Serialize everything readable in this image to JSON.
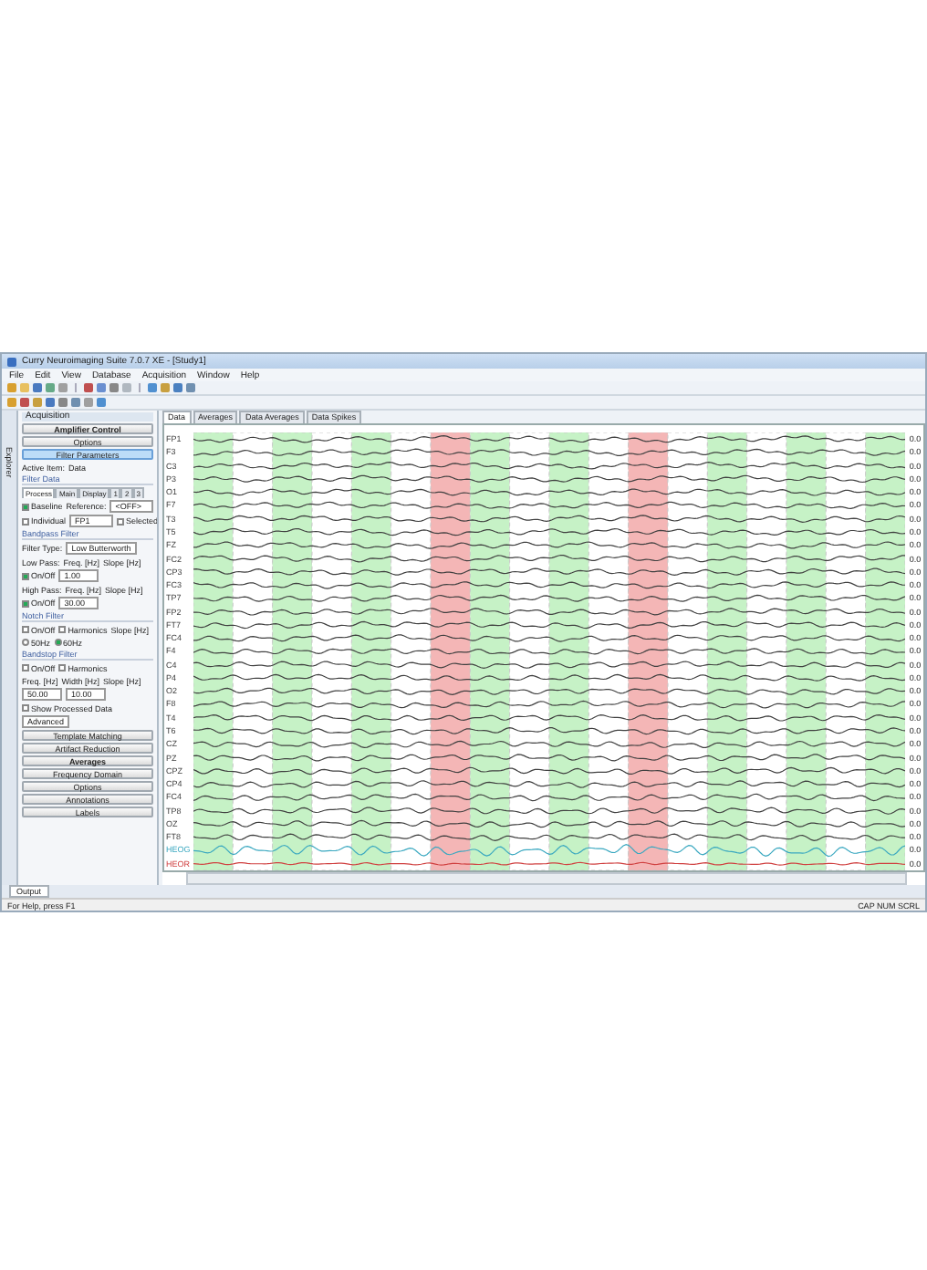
{
  "window": {
    "title": "Curry Neuroimaging Suite 7.0.7 XE - [Study1]"
  },
  "menu": [
    "File",
    "Edit",
    "View",
    "Database",
    "Acquisition",
    "Window",
    "Help"
  ],
  "side_tab": "Explorer",
  "panel": {
    "title": "Acquisition",
    "rows": [
      [
        {
          "kind": "button",
          "label": "Amplifier Control",
          "bold": true,
          "selected": false
        }
      ],
      [
        {
          "kind": "button",
          "label": "Options",
          "bold": false,
          "selected": false
        }
      ],
      [
        {
          "kind": "button",
          "label": "Filter Parameters",
          "bold": false,
          "selected": true
        }
      ],
      [
        {
          "kind": "text",
          "label": "Active Item:"
        },
        {
          "kind": "text",
          "label": "Data"
        }
      ],
      [
        {
          "kind": "section",
          "label": "Filter Data"
        }
      ],
      [
        {
          "kind": "tab",
          "label": "Process",
          "selected": true
        },
        {
          "kind": "tab",
          "label": "Main",
          "selected": false
        },
        {
          "kind": "tab",
          "label": "Display",
          "selected": false
        },
        {
          "kind": "tab",
          "label": "1",
          "selected": false
        },
        {
          "kind": "tab",
          "label": "2",
          "selected": false
        },
        {
          "kind": "tab",
          "label": "3",
          "selected": false
        }
      ],
      [
        {
          "kind": "check",
          "label": "Baseline",
          "checked": true
        },
        {
          "kind": "text",
          "label": "Reference:"
        },
        {
          "kind": "select",
          "label": "<OFF>"
        }
      ],
      [
        {
          "kind": "check",
          "label": "Individual",
          "checked": false
        },
        {
          "kind": "select",
          "label": "FP1"
        },
        {
          "kind": "check",
          "label": "Selected",
          "checked": false
        }
      ],
      [
        {
          "kind": "section",
          "label": "Bandpass Filter"
        }
      ],
      [
        {
          "kind": "text",
          "label": "Filter Type:"
        },
        {
          "kind": "select",
          "label": "Low Butterworth"
        }
      ],
      [
        {
          "kind": "text",
          "label": "Low Pass:"
        },
        {
          "kind": "text",
          "label": "Freq. [Hz]"
        },
        {
          "kind": "text",
          "label": "Slope [Hz]"
        }
      ],
      [
        {
          "kind": "check",
          "label": "On/Off",
          "checked": true
        },
        {
          "kind": "field",
          "label": "1.00"
        }
      ],
      [
        {
          "kind": "text",
          "label": "High Pass:"
        },
        {
          "kind": "text",
          "label": "Freq. [Hz]"
        },
        {
          "kind": "text",
          "label": "Slope [Hz]"
        }
      ],
      [
        {
          "kind": "check",
          "label": "On/Off",
          "checked": true
        },
        {
          "kind": "field",
          "label": "30.00"
        }
      ],
      [
        {
          "kind": "section",
          "label": "Notch Filter"
        }
      ],
      [
        {
          "kind": "check",
          "label": "On/Off",
          "checked": false
        },
        {
          "kind": "check",
          "label": "Harmonics",
          "checked": false
        },
        {
          "kind": "text",
          "label": "Slope [Hz]"
        }
      ],
      [
        {
          "kind": "radio",
          "label": "50Hz",
          "selected": false
        },
        {
          "kind": "radio",
          "label": "60Hz",
          "selected": true
        }
      ],
      [
        {
          "kind": "section",
          "label": "Bandstop Filter"
        }
      ],
      [
        {
          "kind": "check",
          "label": "On/Off",
          "checked": false
        },
        {
          "kind": "check",
          "label": "Harmonics",
          "checked": false
        }
      ],
      [
        {
          "kind": "text",
          "label": "Freq. [Hz]"
        },
        {
          "kind": "text",
          "label": "Width [Hz]"
        },
        {
          "kind": "text",
          "label": "Slope [Hz]"
        }
      ],
      [
        {
          "kind": "field",
          "label": "50.00"
        },
        {
          "kind": "field",
          "label": "10.00"
        }
      ],
      [
        {
          "kind": "check",
          "label": "Show Processed Data",
          "checked": false
        }
      ],
      [
        {
          "kind": "select",
          "label": "Advanced"
        }
      ],
      [
        {
          "kind": "button",
          "label": "Template Matching",
          "bold": false,
          "selected": false
        }
      ],
      [
        {
          "kind": "button",
          "label": "Artifact Reduction",
          "bold": false,
          "selected": false
        }
      ],
      [
        {
          "kind": "button",
          "label": "Averages",
          "bold": true,
          "selected": false
        }
      ],
      [
        {
          "kind": "button",
          "label": "Frequency Domain",
          "bold": false,
          "selected": false
        }
      ],
      [
        {
          "kind": "button",
          "label": "Options",
          "bold": false,
          "selected": false
        }
      ],
      [
        {
          "kind": "button",
          "label": "Annotations",
          "bold": false,
          "selected": false
        }
      ],
      [
        {
          "kind": "button",
          "label": "Labels",
          "bold": false,
          "selected": false
        }
      ]
    ]
  },
  "data_tabs": [
    {
      "label": "Data",
      "selected": true
    },
    {
      "label": "Averages",
      "selected": false
    },
    {
      "label": "Data Averages",
      "selected": false
    },
    {
      "label": "Data Spikes",
      "selected": false
    }
  ],
  "segments": [
    {
      "color": "#c6f2c6"
    },
    {
      "color": "#ffffff"
    },
    {
      "color": "#c6f2c6"
    },
    {
      "color": "#ffffff"
    },
    {
      "color": "#c6f2c6"
    },
    {
      "color": "#ffffff"
    },
    {
      "color": "#f4b6b6"
    },
    {
      "color": "#c6f2c6"
    },
    {
      "color": "#ffffff"
    },
    {
      "color": "#c6f2c6"
    },
    {
      "color": "#ffffff"
    },
    {
      "color": "#f4b6b6"
    },
    {
      "color": "#ffffff"
    },
    {
      "color": "#c6f2c6"
    },
    {
      "color": "#ffffff"
    },
    {
      "color": "#c6f2c6"
    },
    {
      "color": "#ffffff"
    },
    {
      "color": "#c6f2c6"
    }
  ],
  "channels": [
    {
      "name": "FP1",
      "value": "0.0",
      "color": "#404040"
    },
    {
      "name": "F3",
      "value": "0.0",
      "color": "#404040"
    },
    {
      "name": "C3",
      "value": "0.0",
      "color": "#404040"
    },
    {
      "name": "P3",
      "value": "0.0",
      "color": "#404040"
    },
    {
      "name": "O1",
      "value": "0.0",
      "color": "#404040"
    },
    {
      "name": "F7",
      "value": "0.0",
      "color": "#404040"
    },
    {
      "name": "T3",
      "value": "0.0",
      "color": "#404040"
    },
    {
      "name": "T5",
      "value": "0.0",
      "color": "#404040"
    },
    {
      "name": "FZ",
      "value": "0.0",
      "color": "#404040"
    },
    {
      "name": "FC2",
      "value": "0.0",
      "color": "#404040"
    },
    {
      "name": "CP3",
      "value": "0.0",
      "color": "#404040"
    },
    {
      "name": "FC3",
      "value": "0.0",
      "color": "#404040"
    },
    {
      "name": "TP7",
      "value": "0.0",
      "color": "#404040"
    },
    {
      "name": "FP2",
      "value": "0.0",
      "color": "#404040"
    },
    {
      "name": "FT7",
      "value": "0.0",
      "color": "#404040"
    },
    {
      "name": "FC4",
      "value": "0.0",
      "color": "#404040"
    },
    {
      "name": "F4",
      "value": "0.0",
      "color": "#404040"
    },
    {
      "name": "C4",
      "value": "0.0",
      "color": "#404040"
    },
    {
      "name": "P4",
      "value": "0.0",
      "color": "#404040"
    },
    {
      "name": "O2",
      "value": "0.0",
      "color": "#404040"
    },
    {
      "name": "F8",
      "value": "0.0",
      "color": "#404040"
    },
    {
      "name": "T4",
      "value": "0.0",
      "color": "#404040"
    },
    {
      "name": "T6",
      "value": "0.0",
      "color": "#404040"
    },
    {
      "name": "CZ",
      "value": "0.0",
      "color": "#404040"
    },
    {
      "name": "PZ",
      "value": "0.0",
      "color": "#404040"
    },
    {
      "name": "CPZ",
      "value": "0.0",
      "color": "#404040"
    },
    {
      "name": "CP4",
      "value": "0.0",
      "color": "#404040"
    },
    {
      "name": "FC4",
      "value": "0.0",
      "color": "#404040"
    },
    {
      "name": "TP8",
      "value": "0.0",
      "color": "#404040"
    },
    {
      "name": "OZ",
      "value": "0.0",
      "color": "#404040"
    },
    {
      "name": "FT8",
      "value": "0.0",
      "color": "#404040"
    },
    {
      "name": "HEOG",
      "value": "0.0",
      "color": "#3aa8c0"
    },
    {
      "name": "HEOR",
      "value": "0.0",
      "color": "#d04040"
    }
  ],
  "bottom_tabs": [
    {
      "label": "Output",
      "selected": true
    }
  ],
  "status_bar": {
    "left": "For Help, press F1",
    "right": "CAP NUM SCRL"
  }
}
